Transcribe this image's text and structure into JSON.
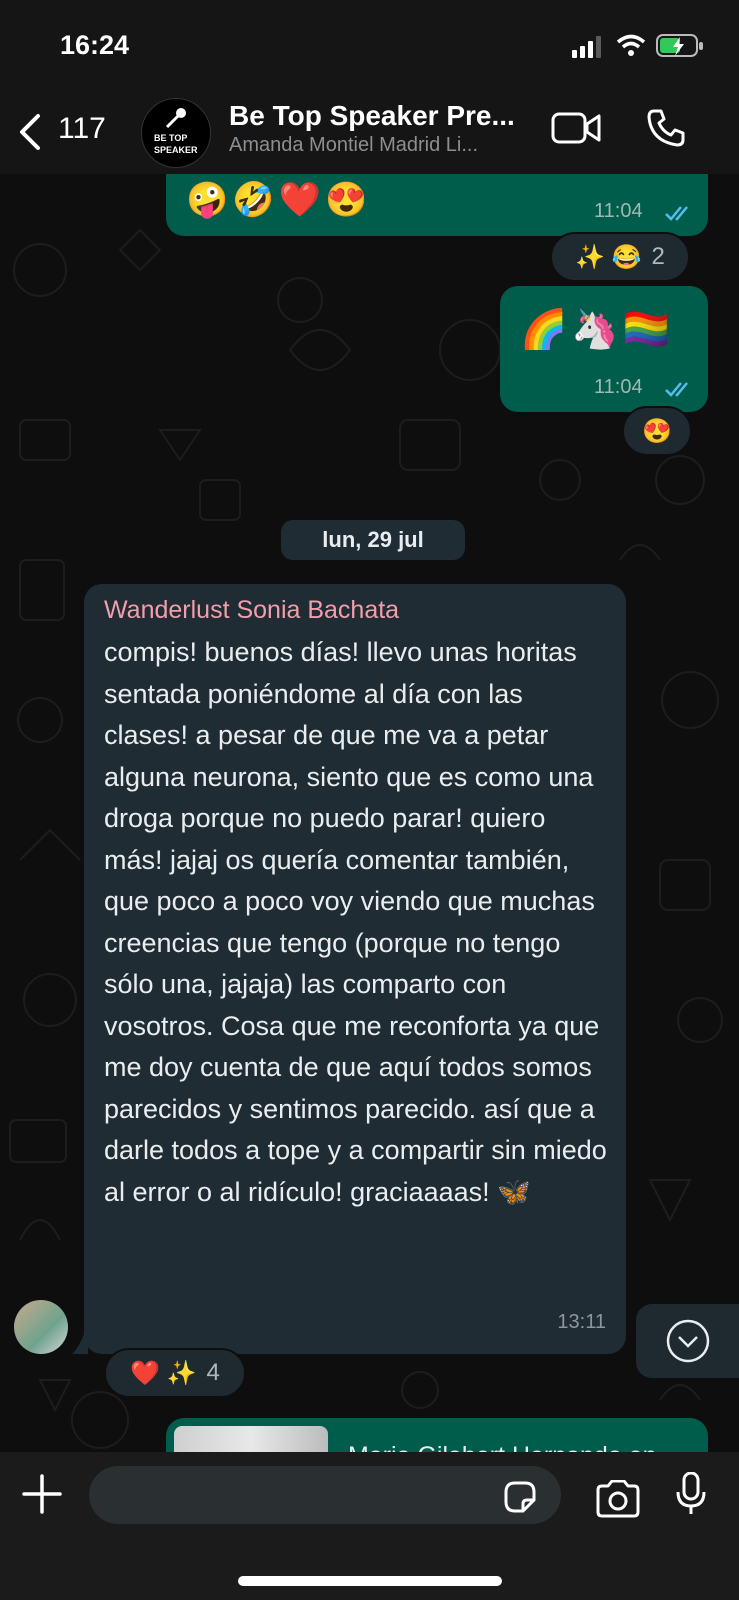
{
  "status": {
    "time": "16:24"
  },
  "header": {
    "back_count": "117",
    "avatar_line1": "BE TOP",
    "avatar_line2": "SPEAKER",
    "title": "Be Top Speaker Pre...",
    "subtitle": "Amanda Montiel Madrid Li..."
  },
  "messages": [
    {
      "emoji": "🤪🤣❤️😍",
      "time": "11:04",
      "reactions": "✨ 😂",
      "reaction_count": "2"
    },
    {
      "emoji": "🌈🦄🏳️‍🌈",
      "time": "11:04",
      "reactions": "😍"
    },
    {
      "date": "lun, 29 jul"
    },
    {
      "sender": "Wanderlust Sonia Bachata",
      "text": "compis! buenos días! llevo unas horitas sentada poniéndome al día con las clases! a pesar de que me va a petar alguna neurona, siento que es como una droga porque no puedo parar! quiero más! jajaj os quería comentar también, que poco a poco voy viendo que muchas creencias que tengo (porque no tengo sólo una, jajaja) las comparto con vosotros. Cosa que me reconforta ya que me doy cuenta de que aquí todos somos parecidos y sentimos parecido. así que a darle todos a tope y a compartir sin miedo al error o al ridículo! graciaaaas! 🦋",
      "time": "13:11",
      "reactions": "❤️ ✨",
      "reaction_count": "4"
    },
    {
      "preview": "Maria Gilabert Hernando an..."
    }
  ],
  "colors": {
    "outgoing": "#005c4b",
    "incoming": "#1f2c34",
    "sender_name": "#f29fab",
    "read_ticks": "#53bdeb"
  }
}
